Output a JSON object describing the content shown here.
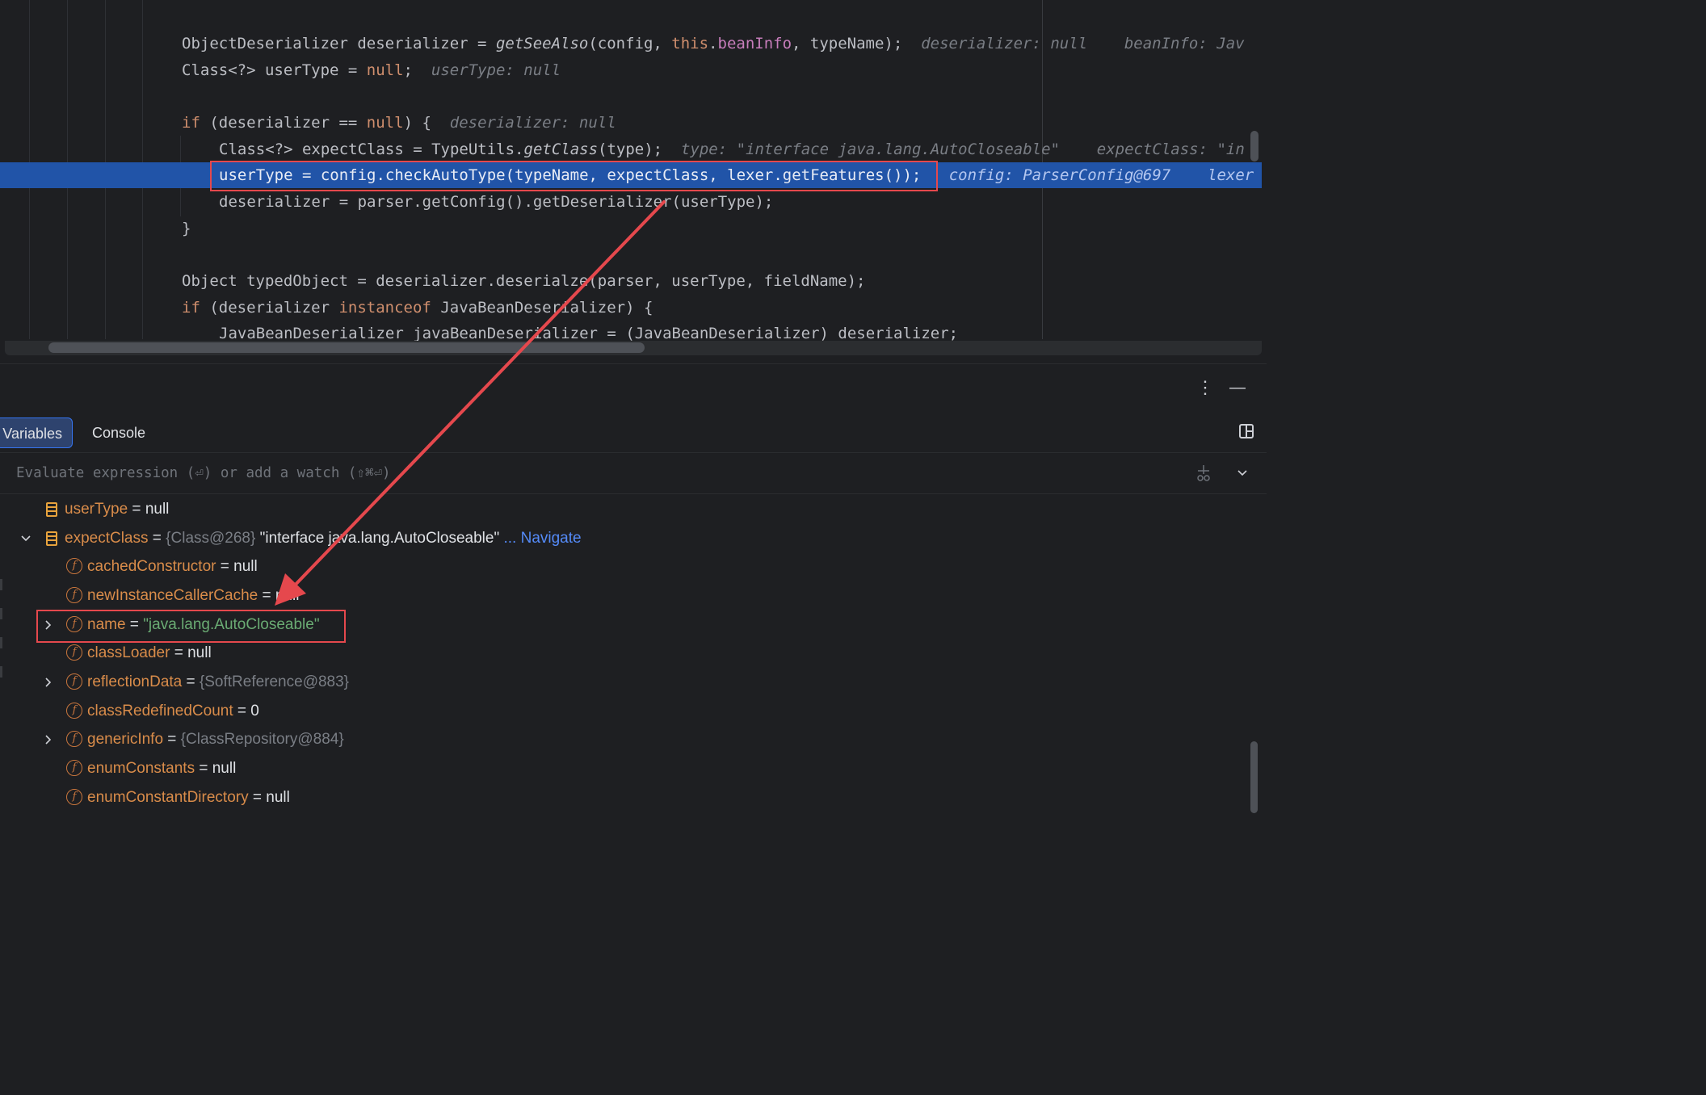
{
  "editor": {
    "lines": [
      {
        "code_a": "ObjectDeserializer deserializer = ",
        "fn": "getSeeAlso",
        "code_b": "(config, ",
        "kw_this": "this",
        "dot": ".",
        "field": "beanInfo",
        "code_c": ", typeName);",
        "hint1": "deserializer: null",
        "hint2": "beanInfo: Jav"
      },
      {
        "code_a": "Class<?> userType = ",
        "kw_null": "null",
        "code_b": ";",
        "hint1": "userType: null"
      },
      {
        "kw_if": "if",
        "code_a": " (deserializer == ",
        "kw_null": "null",
        "code_b": ") {",
        "hint1": "deserializer: null"
      },
      {
        "code_a": "Class<?> expectClass = TypeUtils.",
        "fn": "getClass",
        "code_b": "(type);",
        "hint1": "type: \"interface java.lang.AutoCloseable\"",
        "hint2": "expectClass: \"in"
      },
      {
        "code_a": "userType = config.checkAutoType(typeName, expectClass, lexer.getFeatures());",
        "hint1": "config: ParserConfig@697",
        "hint2": "lexer"
      },
      {
        "code_a": "deserializer = parser.getConfig().getDeserializer(userType);"
      },
      {
        "code_a": "}"
      },
      {
        "code_a": "Object typedObject = deserializer.deserialze(parser, userType, fieldName);"
      },
      {
        "kw_if": "if",
        "code_a": " (deserializer ",
        "kw_inst": "instanceof",
        "code_b": " JavaBeanDeserializer) {"
      },
      {
        "code_a": "JavaBeanDeserializer javaBeanDeserializer = (JavaBeanDeserializer) deserializer;"
      }
    ]
  },
  "panel": {
    "more_icon": "more-vertical-icon",
    "minimize_icon": "minimize-icon",
    "tabs": [
      {
        "label": "Variables"
      },
      {
        "label": "Console"
      }
    ],
    "layout_icon": "layout-icon",
    "eval_placeholder": "Evaluate expression (⏎) or add a watch (⇧⌘⏎)",
    "add_watch_icon": "add-watch-icon",
    "dropdown_icon": "chevron-down-icon"
  },
  "variables": [
    {
      "name": "userType",
      "eq": " = ",
      "value": "null",
      "kind": "local"
    },
    {
      "name": "expectClass",
      "eq": " = ",
      "ref": "{Class@268}",
      "value": "\"interface java.lang.AutoCloseable\"",
      "nav": "... Navigate",
      "kind": "local",
      "expanded": true
    },
    {
      "name": "cachedConstructor",
      "eq": " = ",
      "value": "null",
      "kind": "field"
    },
    {
      "name": "newInstanceCallerCache",
      "eq": " = ",
      "value": "null",
      "kind": "field"
    },
    {
      "name": "name",
      "eq": " = ",
      "value": "\"java.lang.AutoCloseable\"",
      "kind": "field",
      "expandable": true
    },
    {
      "name": "classLoader",
      "eq": " = ",
      "value": "null",
      "kind": "field"
    },
    {
      "name": "reflectionData",
      "eq": " = ",
      "ref": "{SoftReference@883}",
      "kind": "field",
      "expandable": true
    },
    {
      "name": "classRedefinedCount",
      "eq": " = ",
      "value": "0",
      "kind": "field"
    },
    {
      "name": "genericInfo",
      "eq": " = ",
      "ref": "{ClassRepository@884}",
      "kind": "field",
      "expandable": true
    },
    {
      "name": "enumConstants",
      "eq": " = ",
      "value": "null",
      "kind": "field"
    },
    {
      "name": "enumConstantDirectory",
      "eq": " = ",
      "value": "null",
      "kind": "field"
    }
  ],
  "colors": {
    "highlight": "#2154a8",
    "annotation": "#e5484d",
    "string": "#6aab73",
    "navigate": "#548af7"
  }
}
